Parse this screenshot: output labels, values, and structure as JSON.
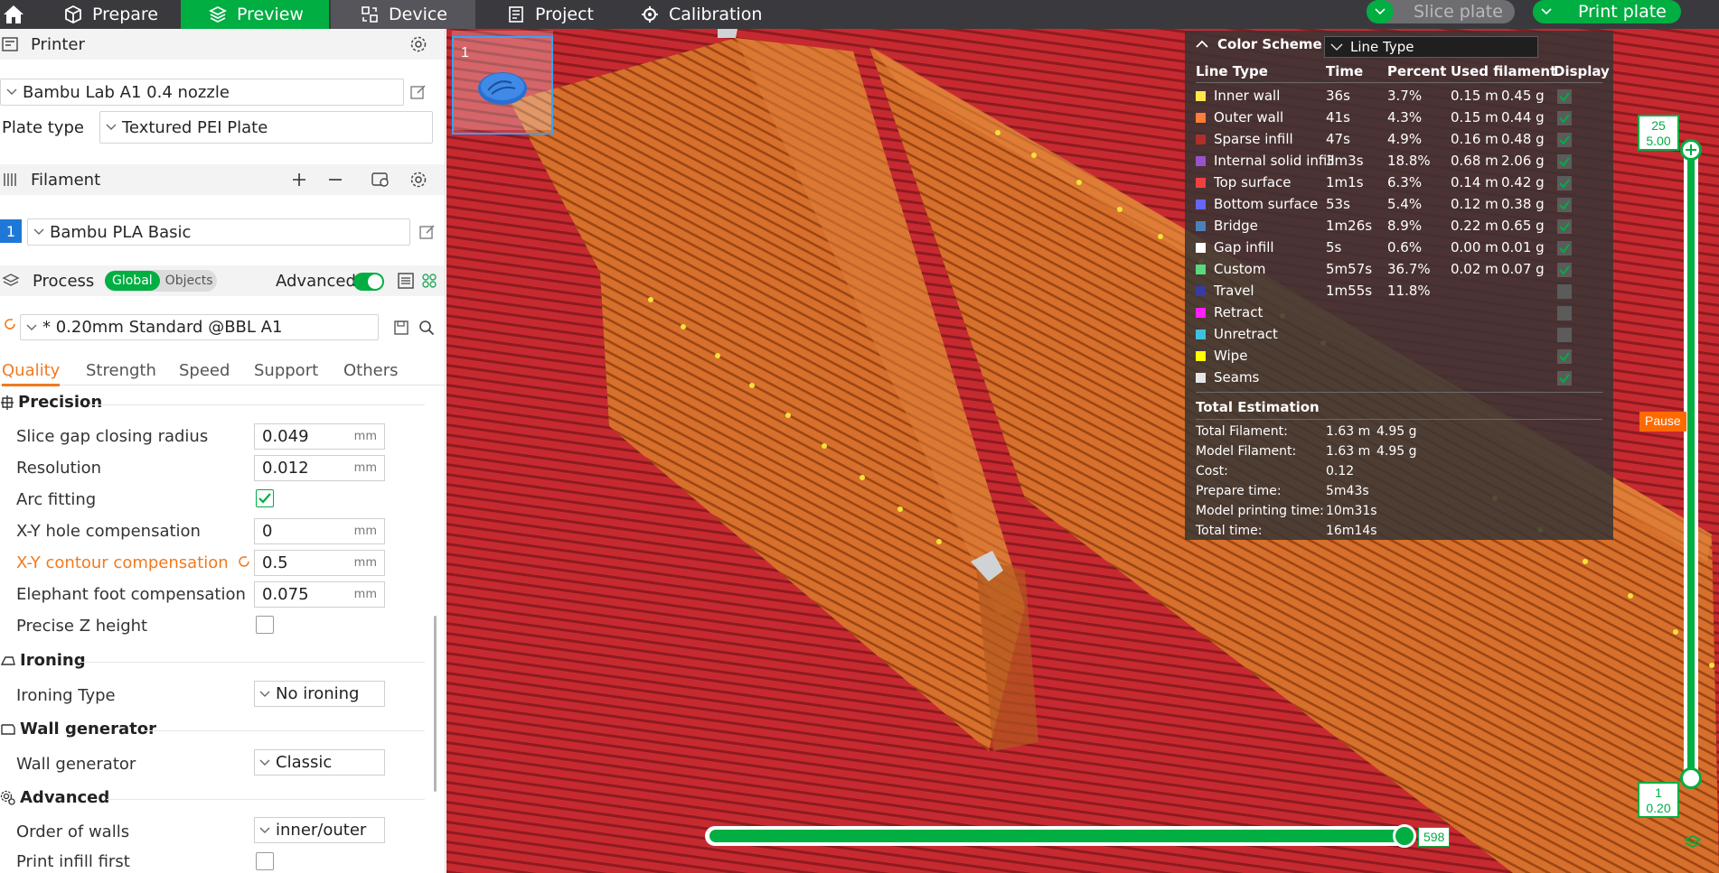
{
  "topbar": {
    "tabs": [
      {
        "label": "Prepare",
        "icon": "cube-icon"
      },
      {
        "label": "Preview",
        "icon": "layers-icon"
      },
      {
        "label": "Device",
        "icon": "device-icon"
      },
      {
        "label": "Project",
        "icon": "project-icon"
      },
      {
        "label": "Calibration",
        "icon": "calibration-icon"
      }
    ],
    "active_tab": "Preview",
    "slice_label": "Slice plate",
    "print_label": "Print plate",
    "accent": "#00ae42"
  },
  "printer": {
    "title": "Printer",
    "name": "Bambu Lab A1 0.4 nozzle",
    "plate_type_label": "Plate type",
    "plate_type": "Textured PEI Plate"
  },
  "filament": {
    "title": "Filament",
    "index": "1",
    "name": "Bambu PLA Basic",
    "index_color": "#1f77d8"
  },
  "process": {
    "title": "Process",
    "toggle_global": "Global",
    "toggle_objects": "Objects",
    "advanced_label": "Advanced",
    "advanced_on": true,
    "profile": "* 0.20mm Standard @BBL A1",
    "tabs": [
      "Quality",
      "Strength",
      "Speed",
      "Support",
      "Others"
    ],
    "active_tab": "Quality"
  },
  "quality": {
    "precision": {
      "title": "Precision",
      "slice_gap": {
        "label": "Slice gap closing radius",
        "value": "0.049",
        "unit": "mm"
      },
      "resolution": {
        "label": "Resolution",
        "value": "0.012",
        "unit": "mm"
      },
      "arc_fitting": {
        "label": "Arc fitting",
        "checked": true
      },
      "xy_hole": {
        "label": "X-Y hole compensation",
        "value": "0",
        "unit": "mm"
      },
      "xy_contour": {
        "label": "X-Y contour compensation",
        "value": "0.5",
        "unit": "mm",
        "modified": true
      },
      "elephant": {
        "label": "Elephant foot compensation",
        "value": "0.075",
        "unit": "mm"
      },
      "precise_z": {
        "label": "Precise Z height",
        "checked": false
      }
    },
    "ironing": {
      "title": "Ironing",
      "type_label": "Ironing Type",
      "type_value": "No ironing"
    },
    "wall_generator": {
      "title": "Wall generator",
      "label": "Wall generator",
      "value": "Classic"
    },
    "advanced": {
      "title": "Advanced",
      "order_label": "Order of walls",
      "order_value": "inner/outer",
      "infill_first_label": "Print infill first",
      "infill_first": false
    }
  },
  "preview": {
    "plate_number": "1",
    "legend": {
      "title": "Color Scheme",
      "scheme": "Line Type",
      "columns": [
        "Line Type",
        "Time",
        "Percent",
        "Used filament",
        "Display"
      ],
      "rows": [
        {
          "name": "Inner wall",
          "color": "#ffe64d",
          "time": "36s",
          "percent": "3.7%",
          "length": "0.15 m",
          "weight": "0.45 g",
          "shown": true
        },
        {
          "name": "Outer wall",
          "color": "#ff7d38",
          "time": "41s",
          "percent": "4.3%",
          "length": "0.15 m",
          "weight": "0.44 g",
          "shown": true
        },
        {
          "name": "Sparse infill",
          "color": "#b03029",
          "time": "47s",
          "percent": "4.9%",
          "length": "0.16 m",
          "weight": "0.48 g",
          "shown": true
        },
        {
          "name": "Internal solid infill",
          "color": "#9654cc",
          "time": "3m3s",
          "percent": "18.8%",
          "length": "0.68 m",
          "weight": "2.06 g",
          "shown": true
        },
        {
          "name": "Top surface",
          "color": "#f04040",
          "time": "1m1s",
          "percent": "6.3%",
          "length": "0.14 m",
          "weight": "0.42 g",
          "shown": true
        },
        {
          "name": "Bottom surface",
          "color": "#6666ff",
          "time": "53s",
          "percent": "5.4%",
          "length": "0.12 m",
          "weight": "0.38 g",
          "shown": true
        },
        {
          "name": "Bridge",
          "color": "#4d80ba",
          "time": "1m26s",
          "percent": "8.9%",
          "length": "0.22 m",
          "weight": "0.65 g",
          "shown": true
        },
        {
          "name": "Gap infill",
          "color": "#ffffff",
          "time": "5s",
          "percent": "0.6%",
          "length": "0.00 m",
          "weight": "0.01 g",
          "shown": true
        },
        {
          "name": "Custom",
          "color": "#5ad780",
          "time": "5m57s",
          "percent": "36.7%",
          "length": "0.02 m",
          "weight": "0.07 g",
          "shown": true
        },
        {
          "name": "Travel",
          "color": "#383ba4",
          "time": "1m55s",
          "percent": "11.8%",
          "length": "",
          "weight": "",
          "shown": false
        },
        {
          "name": "Retract",
          "color": "#ff20ff",
          "time": "",
          "percent": "",
          "length": "",
          "weight": "",
          "shown": false
        },
        {
          "name": "Unretract",
          "color": "#40c0e0",
          "time": "",
          "percent": "",
          "length": "",
          "weight": "",
          "shown": false
        },
        {
          "name": "Wipe",
          "color": "#ffff00",
          "time": "",
          "percent": "",
          "length": "",
          "weight": "",
          "shown": true
        },
        {
          "name": "Seams",
          "color": "#e6e6e6",
          "time": "",
          "percent": "",
          "length": "",
          "weight": "",
          "shown": true
        }
      ],
      "total_title": "Total Estimation",
      "totals": [
        {
          "label": "Total Filament:",
          "length": "1.63 m",
          "weight": "4.95 g"
        },
        {
          "label": "Model Filament:",
          "length": "1.63 m",
          "weight": "4.95 g"
        },
        {
          "label": "Cost:",
          "length": "0.12",
          "weight": ""
        },
        {
          "label": "Prepare time:",
          "length": "5m43s",
          "weight": ""
        },
        {
          "label": "Model printing time:",
          "length": "10m31s",
          "weight": ""
        },
        {
          "label": "Total time:",
          "length": "16m14s",
          "weight": ""
        }
      ]
    },
    "layer_slider": {
      "top_layer": "25",
      "top_height": "5.00",
      "bottom_layer": "1",
      "bottom_height": "0.20",
      "pause_label": "Pause"
    },
    "move_slider": {
      "value": "598"
    }
  }
}
